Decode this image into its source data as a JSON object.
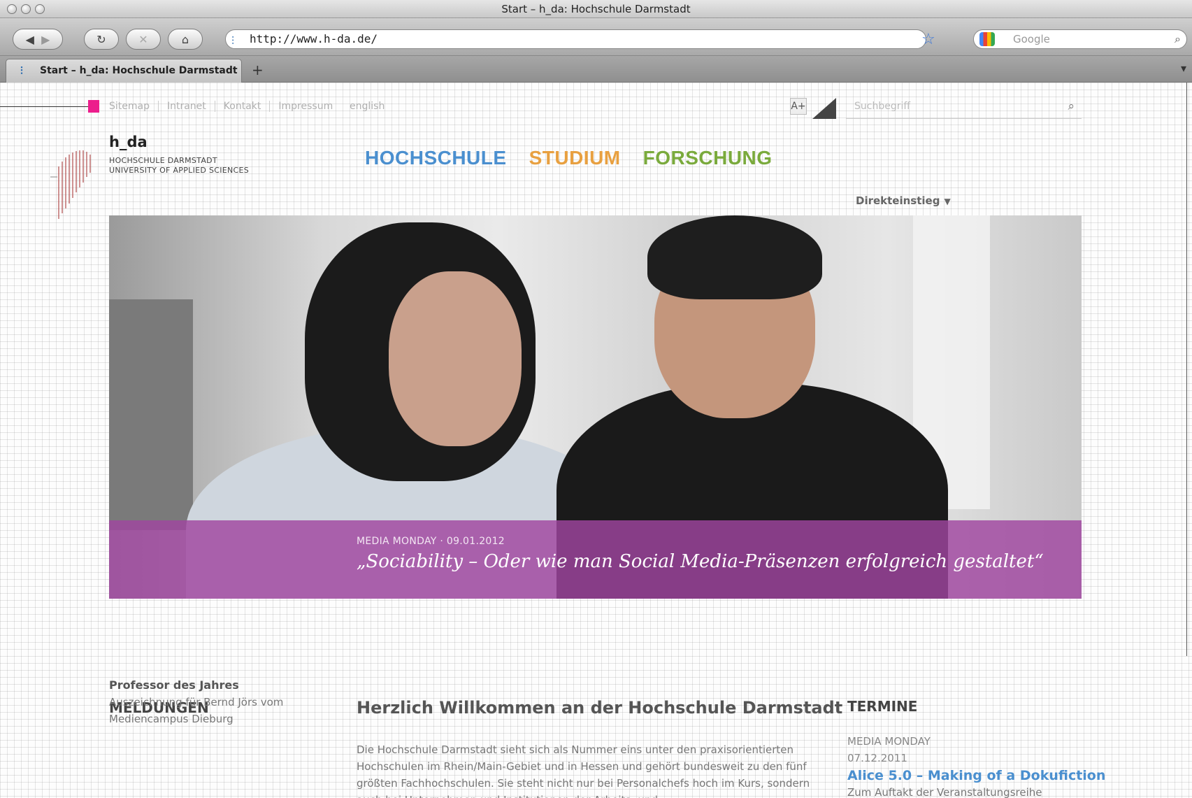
{
  "browser": {
    "window_title": "Start – h_da: Hochschule Darmstadt",
    "url": "http://www.h-da.de/",
    "search_placeholder": "Google",
    "tab_label": "Start – h_da: Hochschule Darmstadt",
    "new_tab_symbol": "+"
  },
  "meta_nav": {
    "items": [
      "Sitemap",
      "Intranet",
      "Kontakt",
      "Impressum"
    ],
    "language": "english",
    "font_size_label": "A+",
    "search_placeholder": "Suchbegriff"
  },
  "logo": {
    "name": "h_da",
    "line1": "HOCHSCHULE DARMSTADT",
    "line2": "UNIVERSITY OF APPLIED SCIENCES"
  },
  "main_nav": {
    "hochschule": "HOCHSCHULE",
    "studium": "STUDIUM",
    "forschung": "FORSCHUNG",
    "colors": {
      "hochschule": "#4a8fcf",
      "studium": "#e8a040",
      "forschung": "#7aaa3c"
    }
  },
  "direkteinstieg": "Direkteinstieg",
  "hero": {
    "kicker": "MEDIA MONDAY · 09.01.2012",
    "title": "„Sociability – Oder wie man Social Media-Präsenzen erfolgreich gestaltet“",
    "caption_color": "#a046a0"
  },
  "meldungen": {
    "heading": "MELDUNGEN",
    "item_title": "Professor des Jahres",
    "item_text": "Auszeichnung für Bernd Jörs vom Mediencampus Dieburg"
  },
  "welcome": {
    "heading": "Herzlich Willkommen an der Hochschule Darmstadt",
    "text": "Die Hochschule Darmstadt sieht sich als Nummer eins unter den praxisorientierten Hochschulen im Rhein/Main-Gebiet und in Hessen und gehört bundesweit zu den fünf größten Fachhochschulen. Sie steht nicht nur bei Personalchefs hoch im Kurs, sondern auch bei Unternehmen und Institutionen der Arbeits- und"
  },
  "termine": {
    "heading": "TERMINE",
    "kicker": "MEDIA MONDAY 07.12.2011",
    "link": "Alice 5.0 – Making of a Dokufiction",
    "text": "Zum Auftakt der Veranstaltungsreihe"
  }
}
